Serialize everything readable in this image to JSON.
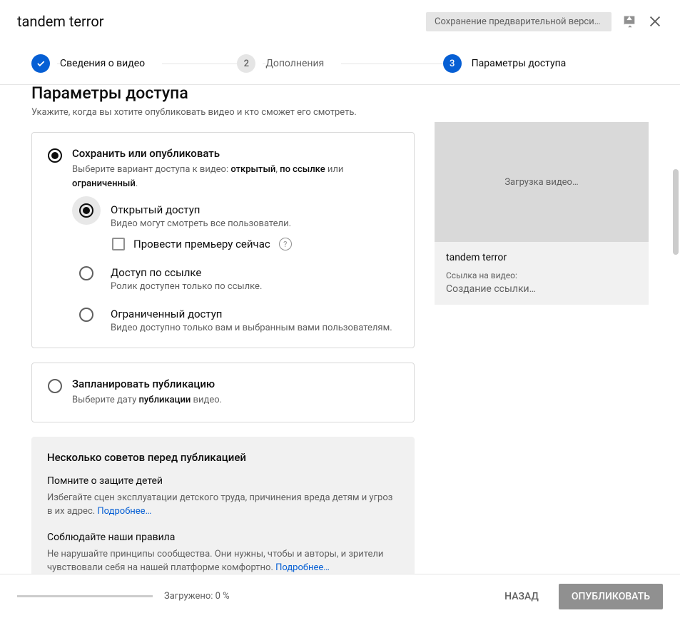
{
  "header": {
    "title": "tandem terror",
    "save_status": "Сохранение предварительной версии…"
  },
  "stepper": {
    "steps": [
      {
        "label": "Сведения о видео"
      },
      {
        "label": "Дополнения",
        "num": "2"
      },
      {
        "label": "Параметры доступа",
        "num": "3"
      }
    ]
  },
  "page": {
    "title": "Параметры доступа",
    "sub": "Укажите, когда вы хотите опубликовать видео и кто сможет его смотреть."
  },
  "publish": {
    "title": "Сохранить или опубликовать",
    "desc_pre": "Выберите вариант доступа к видео: ",
    "b1": "открытый",
    "sep1": ", ",
    "b2": "по ссылке",
    "sep2": " или ",
    "b3": "ограниченный",
    "tail": ".",
    "options": [
      {
        "title": "Открытый доступ",
        "desc": "Видео могут смотреть все пользователи."
      },
      {
        "title": "Доступ по ссылке",
        "desc": "Ролик доступен только по ссылке."
      },
      {
        "title": "Ограниченный доступ",
        "desc": "Видео доступно только вам и выбранным вами пользователям."
      }
    ],
    "premiere_label": "Провести премьеру сейчас"
  },
  "schedule": {
    "title": "Запланировать публикацию",
    "desc_pre": "Выберите дату ",
    "b1": "публикации",
    "tail": " видео."
  },
  "tips": {
    "title": "Несколько советов перед публикацией",
    "items": [
      {
        "h": "Помните о защите детей",
        "p": "Избегайте сцен эксплуатации детского труда, причинения вреда детям и угроз в их адрес. ",
        "link": "Подробнее…"
      },
      {
        "h": "Соблюдайте наши правила",
        "p": "Не нарушайте принципы сообщества. Они нужны, чтобы и авторы, и зрители чувствовали себя на нашей платформе комфортно. ",
        "link": "Подробнее…"
      }
    ]
  },
  "preview": {
    "loading": "Загрузка видео…",
    "title": "tandem terror",
    "link_label": "Ссылка на видео:",
    "link_status": "Создание ссылки…"
  },
  "footer": {
    "upload": "Загружено: 0 %",
    "back": "НАЗАД",
    "publish": "ОПУБЛИКОВАТЬ"
  }
}
